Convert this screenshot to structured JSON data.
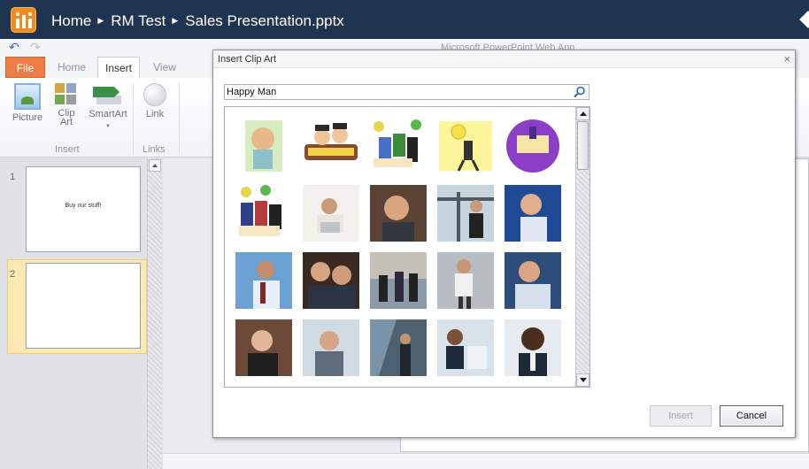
{
  "nav": {
    "logo_icon": "sharepoint-logo",
    "breadcrumbs": [
      "Home",
      "RM Test",
      "Sales Presentation.pptx"
    ]
  },
  "app_title": "Microsoft PowerPoint Web App",
  "ribbon": {
    "tabs": [
      "File",
      "Home",
      "Insert",
      "View"
    ],
    "active_tab": "Insert",
    "buttons": [
      {
        "label": "Picture",
        "icon": "picture-icon"
      },
      {
        "label": "Clip\nArt",
        "icon": "clip-art-icon"
      },
      {
        "label": "SmartArt",
        "icon": "smartart-icon"
      },
      {
        "label": "Link",
        "icon": "link-icon"
      }
    ],
    "groups": [
      "Insert",
      "Links"
    ]
  },
  "slides": [
    {
      "number": "1",
      "text": "Buy our stuff!"
    },
    {
      "number": "2",
      "text": ""
    }
  ],
  "dialog": {
    "title": "Insert Clip Art",
    "close_glyph": "×",
    "search_value": "Happy Man",
    "insert_label": "Insert",
    "cancel_label": "Cancel",
    "clips": [
      "bald-man-profile",
      "happy-thanksgiving-pilgrims",
      "happy-retirement-group",
      "sun-man-flashlight",
      "million-dollar-check",
      "happy-retirement-office",
      "business-meeting-laptop",
      "smiling-businessman-portrait",
      "businessman-at-window",
      "businessman-laughing",
      "businessman-on-phone",
      "smiling-men-pair",
      "business-team-standing",
      "businessman-walking",
      "businessman-phone-call",
      "smiling-businesswoman",
      "businesswoman-phone",
      "businessman-glass-building",
      "businessmen-handshake",
      "smiling-black-businessman"
    ]
  },
  "colors": {
    "topbar": "#1f3450",
    "file_tab": "#ee7d45",
    "logo": "#f08c1e",
    "selected_slide": "#fce8b2"
  }
}
